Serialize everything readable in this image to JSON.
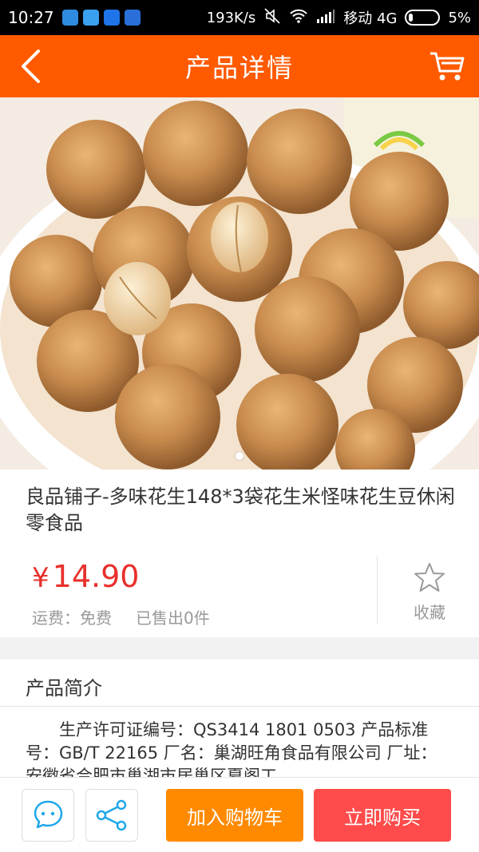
{
  "status_bar": {
    "time": "10:27",
    "speed": "193K/s",
    "carrier": "移动 4G",
    "battery": "5%"
  },
  "header": {
    "title": "产品详情",
    "color": "#ff5a00"
  },
  "hero": {
    "slide_count": 1,
    "active_index": 0
  },
  "product": {
    "title": "良品铺子-多味花生148*3袋花生米怪味花生豆休闲零食品",
    "currency": "¥",
    "price": "14.90",
    "shipping": "运费：免费",
    "sold": "已售出0件",
    "favorite_label": "收藏",
    "price_color": "#e8302c"
  },
  "intro": {
    "title": "产品简介",
    "text": "生产许可证编号：QS3414 1801 0503 产品标准号：GB/T 22165 厂名：巢湖旺角食品有限公司 厂址：安徽省合肥市巢湖市居巢区夏阁工"
  },
  "bottom_bar": {
    "add_to_cart": "加入购物车",
    "buy_now": "立即购买",
    "add_color": "#ff8a00",
    "buy_color": "#ff4b4b"
  }
}
